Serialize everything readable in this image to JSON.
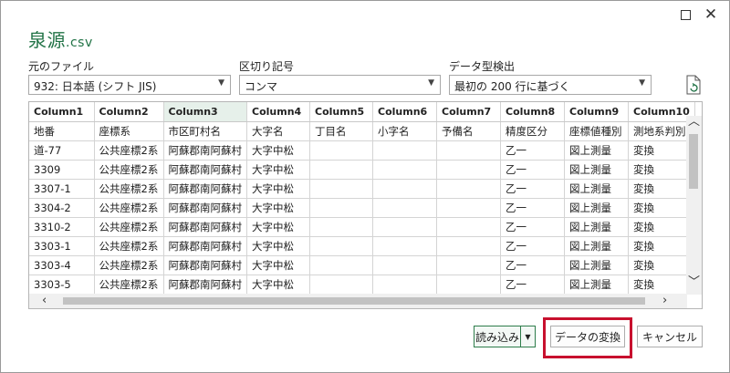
{
  "dialog": {
    "title_name": "泉源",
    "title_ext": ".csv"
  },
  "window_controls": {
    "maximize_label": "",
    "close_label": "✕"
  },
  "options": {
    "file_origin": {
      "label": "元のファイル",
      "value": "932: 日本語 (シフト JIS)"
    },
    "delimiter": {
      "label": "区切り記号",
      "value": "コンマ"
    },
    "type_detection": {
      "label": "データ型検出",
      "value": "最初の 200 行に基づく"
    }
  },
  "preview": {
    "columns": [
      "Column1",
      "Column2",
      "Column3",
      "Column4",
      "Column5",
      "Column6",
      "Column7",
      "Column8",
      "Column9",
      "Column10"
    ],
    "rows": [
      [
        "地番",
        "座標系",
        "市区町村名",
        "大字名",
        "丁目名",
        "小字名",
        "予備名",
        "精度区分",
        "座標値種別",
        "測地系判別"
      ],
      [
        "道-77",
        "公共座標2系",
        "阿蘇郡南阿蘇村",
        "大字中松",
        "",
        "",
        "",
        "乙一",
        "図上測量",
        "変換"
      ],
      [
        "3309",
        "公共座標2系",
        "阿蘇郡南阿蘇村",
        "大字中松",
        "",
        "",
        "",
        "乙一",
        "図上測量",
        "変換"
      ],
      [
        "3307-1",
        "公共座標2系",
        "阿蘇郡南阿蘇村",
        "大字中松",
        "",
        "",
        "",
        "乙一",
        "図上測量",
        "変換"
      ],
      [
        "3304-2",
        "公共座標2系",
        "阿蘇郡南阿蘇村",
        "大字中松",
        "",
        "",
        "",
        "乙一",
        "図上測量",
        "変換"
      ],
      [
        "3310-2",
        "公共座標2系",
        "阿蘇郡南阿蘇村",
        "大字中松",
        "",
        "",
        "",
        "乙一",
        "図上測量",
        "変換"
      ],
      [
        "3303-1",
        "公共座標2系",
        "阿蘇郡南阿蘇村",
        "大字中松",
        "",
        "",
        "",
        "乙一",
        "図上測量",
        "変換"
      ],
      [
        "3303-4",
        "公共座標2系",
        "阿蘇郡南阿蘇村",
        "大字中松",
        "",
        "",
        "",
        "乙一",
        "図上測量",
        "変換"
      ],
      [
        "3303-5",
        "公共座標2系",
        "阿蘇郡南阿蘇村",
        "大字中松",
        "",
        "",
        "",
        "乙一",
        "図上測量",
        "変換"
      ]
    ]
  },
  "buttons": {
    "load": "読み込み",
    "load_arrow": "▼",
    "transform": "データの変換",
    "cancel": "キャンセル"
  },
  "colors": {
    "accent_green": "#217346",
    "highlight_red": "#c8102e"
  }
}
